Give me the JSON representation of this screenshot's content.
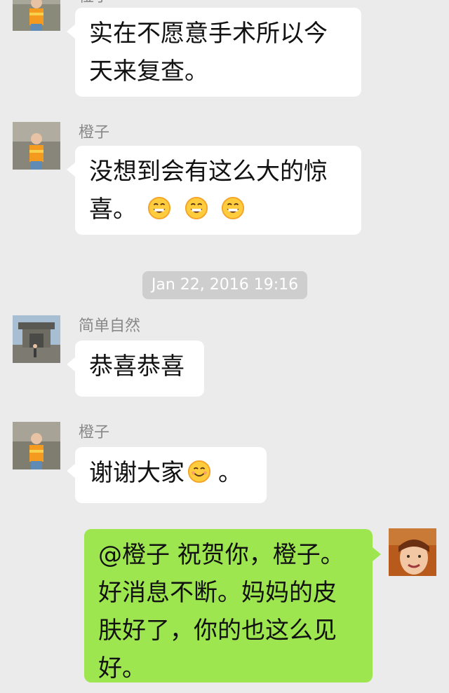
{
  "messages": [
    {
      "sender": "",
      "text": "实在不愿意手术所以今天来复查。"
    },
    {
      "sender": "橙子",
      "text": "没想到会有这么大的惊喜。",
      "emojis": [
        "grinning-face",
        "grinning-face",
        "grinning-face"
      ]
    },
    {
      "sender": "简单自然",
      "text": "恭喜恭喜"
    },
    {
      "sender": "橙子",
      "text": "谢谢大家",
      "suffix": "。",
      "emojis": [
        "smiling-face"
      ]
    },
    {
      "sender": "",
      "text": "@橙子 祝贺你，橙子。好消息不断。妈妈的皮肤好了，你的也这么见好。"
    }
  ],
  "timestamp": "Jan 22, 2016 19:16",
  "colors": {
    "chat_background": "#ebebeb",
    "incoming_bubble": "#ffffff",
    "outgoing_bubble": "#9ee650",
    "timestamp_pill": "#cecece"
  }
}
